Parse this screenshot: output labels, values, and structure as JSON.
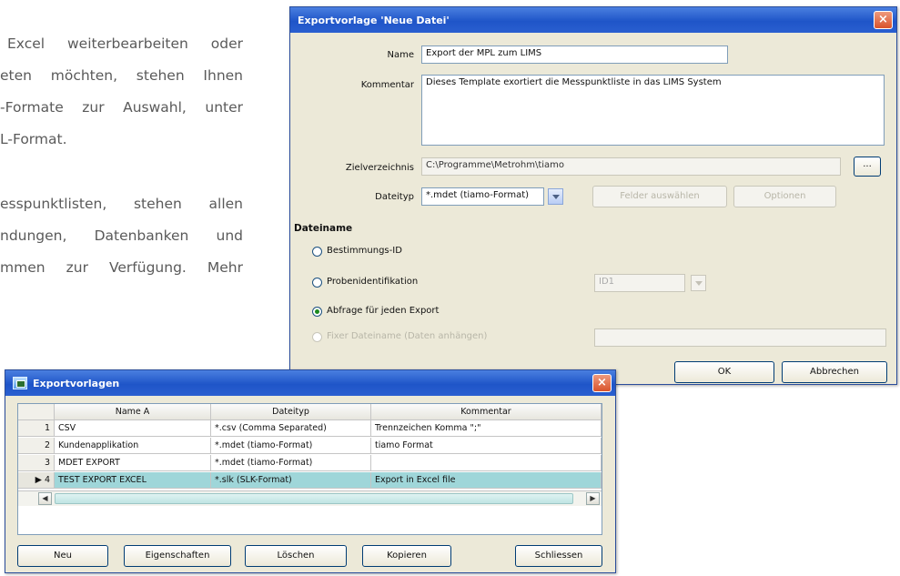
{
  "brochure": {
    "lines": [
      "Excel weiterbearbeiten oder",
      "eten möchten, stehen Ihnen",
      "-Formate zur Auswahl, unter",
      "L-Format.",
      "esspunktlisten, stehen allen",
      "ndungen, Datenbanken und",
      "mmen zur Verfügung. Mehr"
    ]
  },
  "export_dialog": {
    "title": "Exportvorlage 'Neue Datei'",
    "close_label": "×",
    "name_label": "Name",
    "name_value": "Export der MPL zum LIMS",
    "comment_label": "Kommentar",
    "comment_value": "Dieses Template exortiert die Messpunktliste in das LIMS System",
    "target_dir_label": "Zielverzeichnis",
    "target_dir_value": "C:\\Programme\\Metrohm\\tiamo",
    "browse_label": "...",
    "filetype_label": "Dateityp",
    "filetype_value": "*.mdet (tiamo-Format)",
    "select_fields_label": "Felder auswählen",
    "options_label": "Optionen",
    "filename_section": "Dateiname",
    "radio_options": [
      {
        "label": "Bestimmungs-ID",
        "checked": false,
        "disabled": false
      },
      {
        "label": "Probenidentifikation",
        "checked": false,
        "disabled": false
      },
      {
        "label": "Abfrage für jeden Export",
        "checked": true,
        "disabled": false
      },
      {
        "label": "Fixer Dateiname (Daten anhängen)",
        "checked": false,
        "disabled": true
      }
    ],
    "sample_id_value": "ID1",
    "ok_label": "OK",
    "cancel_label": "Abbrechen"
  },
  "templates_window": {
    "title": "Exportvorlagen",
    "close_label": "×",
    "columns": [
      "",
      "Name A",
      "Dateityp",
      "Kommentar"
    ],
    "rows": [
      {
        "num": "1",
        "name": "CSV",
        "type": "*.csv (Comma Separated)",
        "comment": "Trennzeichen Komma \";\""
      },
      {
        "num": "2",
        "name": "Kundenapplikation",
        "type": "*.mdet (tiamo-Format)",
        "comment": "tiamo Format"
      },
      {
        "num": "3",
        "name": "MDET EXPORT",
        "type": "*.mdet (tiamo-Format)",
        "comment": ""
      },
      {
        "num": "▶ 4",
        "name": "TEST EXPORT EXCEL",
        "type": "*.slk (SLK-Format)",
        "comment": "Export in Excel file"
      }
    ],
    "selected_row": 3,
    "buttons": {
      "new": "Neu",
      "properties": "Eigenschaften",
      "delete": "Löschen",
      "copy": "Kopieren",
      "close": "Schliessen"
    }
  }
}
